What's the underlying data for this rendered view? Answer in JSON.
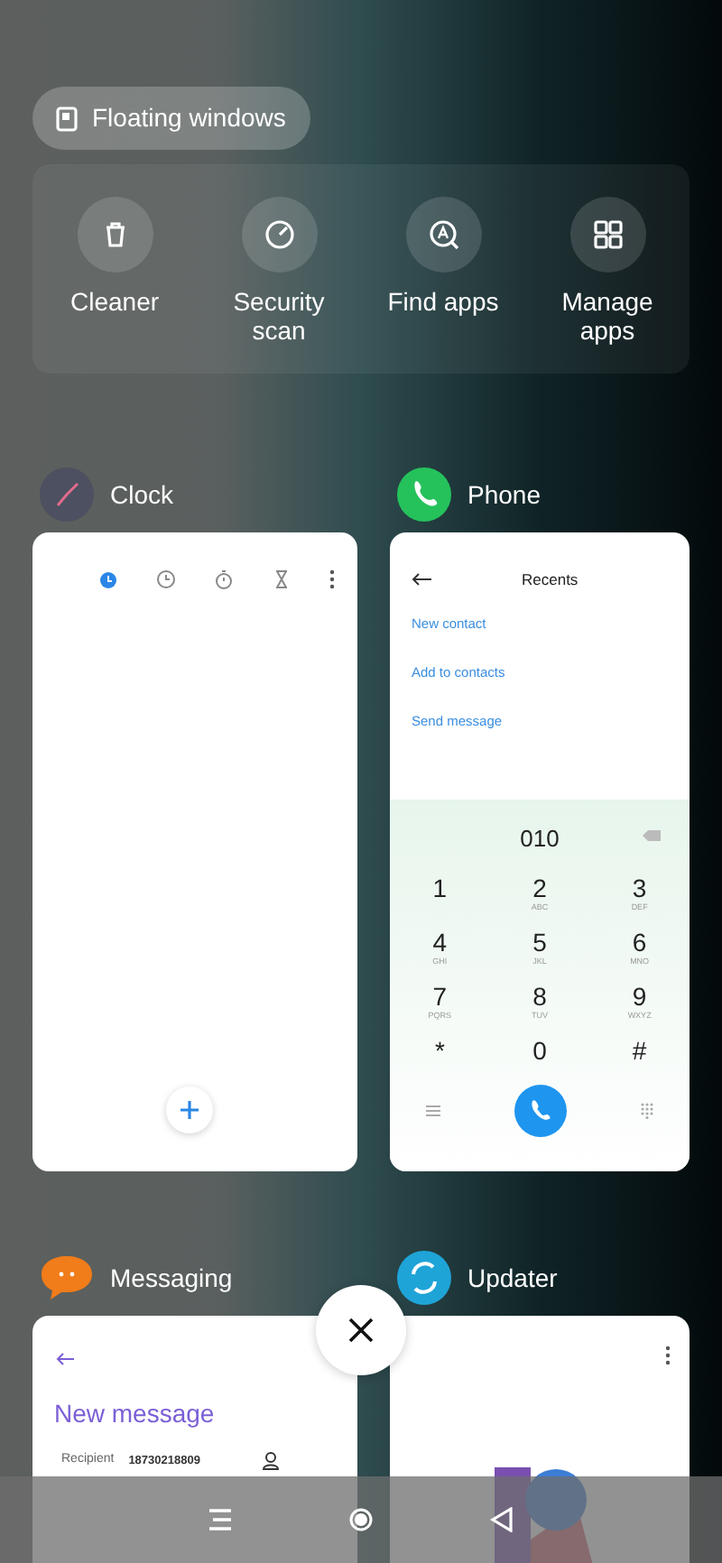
{
  "floating_windows": {
    "label": "Floating windows"
  },
  "tools": [
    {
      "label": "Cleaner",
      "kind": "trash"
    },
    {
      "label": "Security scan",
      "kind": "gauge"
    },
    {
      "label": "Find apps",
      "kind": "find"
    },
    {
      "label": "Manage apps",
      "kind": "grid"
    }
  ],
  "apps": [
    {
      "name": "Clock",
      "kind": "clock",
      "tabs": [
        {
          "kind": "alarm",
          "selected": true
        },
        {
          "kind": "clock",
          "selected": false
        },
        {
          "kind": "stopwatch",
          "selected": false
        },
        {
          "kind": "timer",
          "selected": false
        }
      ]
    },
    {
      "name": "Phone",
      "kind": "phone",
      "title": "Recents",
      "links": [
        "New contact",
        "Add to contacts",
        "Send message"
      ],
      "number": "010",
      "keys": [
        {
          "digit": "1"
        },
        {
          "digit": "2",
          "letters": "ABC"
        },
        {
          "digit": "3",
          "letters": "DEF"
        },
        {
          "digit": "4",
          "letters": "GHI"
        },
        {
          "digit": "5",
          "letters": "JKL"
        },
        {
          "digit": "6",
          "letters": "MNO"
        },
        {
          "digit": "7",
          "letters": "PQRS"
        },
        {
          "digit": "8",
          "letters": "TUV"
        },
        {
          "digit": "9",
          "letters": "WXYZ"
        },
        {
          "digit": "*"
        },
        {
          "digit": "0"
        },
        {
          "digit": "#"
        }
      ]
    },
    {
      "name": "Messaging",
      "kind": "messaging",
      "title": "New message",
      "recipient_label": "Recipient",
      "recipient": "18730218809"
    },
    {
      "name": "Updater",
      "kind": "updater"
    }
  ]
}
